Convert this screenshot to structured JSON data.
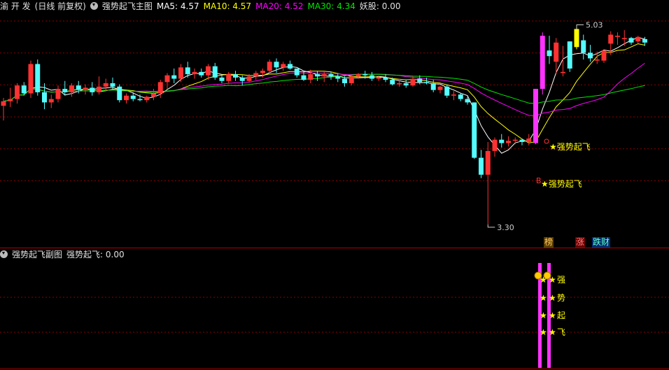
{
  "main_header": {
    "stock": "渝 开 发",
    "mode": "(日线 前复权)",
    "indicator": "强势起飞主图",
    "ma5_label": "MA5:",
    "ma5": "4.57",
    "ma10_label": "MA10:",
    "ma10": "4.57",
    "ma20_label": "MA20:",
    "ma20": "4.52",
    "ma30_label": "MA30:",
    "ma30": "4.34",
    "yao_label": "妖股:",
    "yao": "0.00"
  },
  "sub_header": {
    "indicator": "强势起飞副图",
    "value_label": "强势起飞:",
    "value": "0.00"
  },
  "annotations": {
    "high": "5.03",
    "low": "3.30",
    "signal1": "★强势起飞",
    "signal2": "★强势起飞",
    "b_marker": "B"
  },
  "badges": {
    "bang": "榜",
    "zhang": "涨",
    "diecai": "跌财"
  },
  "sub_labels": [
    "强",
    "势",
    "起",
    "飞"
  ],
  "colors": {
    "up": "#ff3232",
    "down": "#54fcfc",
    "ma5": "#ffffff",
    "ma10": "#ffff00",
    "ma20": "#ff00ff",
    "ma30": "#00e600",
    "grid": "#8c0000",
    "magenta": "#ff33ff"
  },
  "chart_data": {
    "type": "candlestick",
    "ohlc": [
      [
        4.35,
        4.42,
        4.22,
        4.39
      ],
      [
        4.39,
        4.51,
        4.34,
        4.41
      ],
      [
        4.41,
        4.55,
        4.37,
        4.53
      ],
      [
        4.53,
        4.56,
        4.44,
        4.46
      ],
      [
        4.46,
        4.75,
        4.42,
        4.72
      ],
      [
        4.72,
        4.76,
        4.44,
        4.47
      ],
      [
        4.47,
        4.55,
        4.32,
        4.38
      ],
      [
        4.38,
        4.45,
        4.33,
        4.41
      ],
      [
        4.41,
        4.53,
        4.38,
        4.5
      ],
      [
        4.5,
        4.57,
        4.44,
        4.47
      ],
      [
        4.47,
        4.55,
        4.43,
        4.53
      ],
      [
        4.53,
        4.57,
        4.46,
        4.49
      ],
      [
        4.49,
        4.54,
        4.45,
        4.51
      ],
      [
        4.51,
        4.56,
        4.44,
        4.47
      ],
      [
        4.47,
        4.61,
        4.45,
        4.52
      ],
      [
        4.52,
        4.59,
        4.48,
        4.55
      ],
      [
        4.55,
        4.6,
        4.5,
        4.52
      ],
      [
        4.52,
        4.54,
        4.38,
        4.4
      ],
      [
        4.4,
        4.46,
        4.37,
        4.44
      ],
      [
        4.44,
        4.47,
        4.39,
        4.41
      ],
      [
        4.41,
        4.45,
        4.39,
        4.4
      ],
      [
        4.4,
        4.44,
        4.38,
        4.43
      ],
      [
        4.43,
        4.5,
        4.4,
        4.46
      ],
      [
        4.46,
        4.58,
        4.42,
        4.56
      ],
      [
        4.56,
        4.64,
        4.5,
        4.62
      ],
      [
        4.62,
        4.68,
        4.55,
        4.59
      ],
      [
        4.59,
        4.72,
        4.56,
        4.69
      ],
      [
        4.69,
        4.74,
        4.6,
        4.63
      ],
      [
        4.63,
        4.68,
        4.59,
        4.65
      ],
      [
        4.65,
        4.68,
        4.6,
        4.62
      ],
      [
        4.62,
        4.72,
        4.58,
        4.7
      ],
      [
        4.7,
        4.73,
        4.58,
        4.6
      ],
      [
        4.6,
        4.62,
        4.55,
        4.57
      ],
      [
        4.57,
        4.65,
        4.55,
        4.63
      ],
      [
        4.63,
        4.66,
        4.57,
        4.6
      ],
      [
        4.6,
        4.62,
        4.53,
        4.57
      ],
      [
        4.57,
        4.63,
        4.56,
        4.61
      ],
      [
        4.61,
        4.66,
        4.58,
        4.64
      ],
      [
        4.64,
        4.68,
        4.6,
        4.66
      ],
      [
        4.66,
        4.76,
        4.64,
        4.74
      ],
      [
        4.74,
        4.77,
        4.64,
        4.69
      ],
      [
        4.69,
        4.74,
        4.66,
        4.72
      ],
      [
        4.72,
        4.75,
        4.67,
        4.68
      ],
      [
        4.68,
        4.68,
        4.6,
        4.62
      ],
      [
        4.62,
        4.66,
        4.57,
        4.58
      ],
      [
        4.58,
        4.67,
        4.55,
        4.63
      ],
      [
        4.63,
        4.66,
        4.57,
        4.61
      ],
      [
        4.61,
        4.65,
        4.56,
        4.63
      ],
      [
        4.63,
        4.65,
        4.58,
        4.61
      ],
      [
        4.61,
        4.64,
        4.56,
        4.59
      ],
      [
        4.59,
        4.61,
        4.52,
        4.55
      ],
      [
        4.55,
        4.62,
        4.53,
        4.61
      ],
      [
        4.61,
        4.64,
        4.59,
        4.63
      ],
      [
        4.63,
        4.66,
        4.59,
        4.62
      ],
      [
        4.62,
        4.65,
        4.57,
        4.59
      ],
      [
        4.59,
        4.62,
        4.57,
        4.6
      ],
      [
        4.6,
        4.63,
        4.56,
        4.58
      ],
      [
        4.58,
        4.6,
        4.53,
        4.54
      ],
      [
        4.54,
        4.59,
        4.52,
        4.55
      ],
      [
        4.55,
        4.58,
        4.51,
        4.53
      ],
      [
        4.53,
        4.61,
        4.52,
        4.59
      ],
      [
        4.59,
        4.62,
        4.54,
        4.56
      ],
      [
        4.56,
        4.6,
        4.54,
        4.55
      ],
      [
        4.55,
        4.58,
        4.47,
        4.49
      ],
      [
        4.49,
        4.53,
        4.46,
        4.52
      ],
      [
        4.52,
        4.54,
        4.42,
        4.44
      ],
      [
        4.44,
        4.48,
        4.4,
        4.45
      ],
      [
        4.45,
        4.46,
        4.39,
        4.41
      ],
      [
        4.41,
        4.43,
        4.36,
        4.38
      ],
      [
        4.38,
        4.38,
        3.88,
        3.89
      ],
      [
        3.89,
        3.96,
        3.71,
        3.74
      ],
      [
        3.74,
        4.03,
        3.3,
        3.95
      ],
      [
        3.95,
        4.07,
        3.9,
        4.05
      ],
      [
        4.05,
        4.1,
        3.98,
        4.02
      ],
      [
        4.02,
        4.08,
        3.99,
        4.04
      ],
      [
        4.04,
        4.07,
        4.01,
        4.05
      ],
      [
        4.05,
        4.06,
        4.0,
        4.03
      ],
      [
        4.03,
        4.1,
        4.0,
        4.06
      ],
      [
        4.02,
        4.5,
        4.01,
        4.5
      ],
      [
        4.5,
        5.0,
        4.45,
        4.97
      ],
      [
        4.84,
        4.97,
        4.72,
        4.79
      ],
      [
        4.74,
        4.95,
        4.63,
        4.91
      ],
      [
        4.64,
        4.88,
        4.61,
        4.65
      ],
      [
        4.92,
        4.92,
        4.65,
        4.68
      ],
      [
        4.87,
        5.03,
        4.85,
        5.03
      ],
      [
        4.93,
        4.98,
        4.76,
        4.82
      ],
      [
        4.82,
        4.89,
        4.74,
        4.77
      ],
      [
        4.75,
        4.83,
        4.72,
        4.76
      ],
      [
        4.75,
        4.84,
        4.73,
        4.84
      ],
      [
        4.9,
        5.01,
        4.8,
        4.98
      ],
      [
        4.96,
        5.0,
        4.89,
        4.97
      ],
      [
        4.94,
        5.02,
        4.88,
        4.95
      ],
      [
        4.95,
        4.96,
        4.89,
        4.91
      ],
      [
        4.92,
        4.97,
        4.9,
        4.96
      ],
      [
        4.94,
        4.96,
        4.88,
        4.91
      ]
    ],
    "special_bars": {
      "magenta": [
        78,
        79
      ],
      "yellow": [
        84
      ]
    },
    "y_range": [
      3.2,
      5.2
    ]
  }
}
